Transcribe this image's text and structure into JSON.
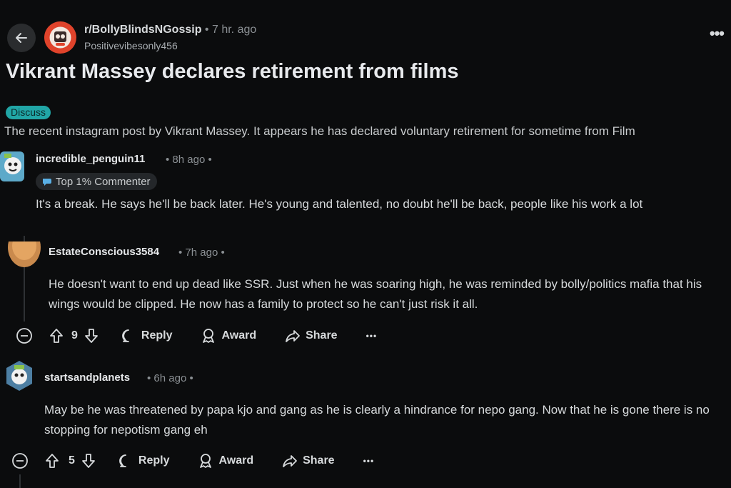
{
  "header": {
    "subreddit": "r/BollyBlindsNGossip",
    "separator": "•",
    "time": "7 hr. ago",
    "author": "Positivevibesonly456",
    "more": "•••",
    "back_icon": "arrow-left-icon"
  },
  "post": {
    "title": "Vikrant Massey declares retirement from films",
    "flair": "Discuss",
    "body": "The recent instagram post by Vikrant Massey. It appears he has declared voluntary retirement for sometime from Film"
  },
  "comments": [
    {
      "username": "incredible_penguin11",
      "meta": "• 8h ago •",
      "badge": "Top 1% Commenter",
      "text": "It's a break. He says he'll be back later. He's young and talented, no doubt he'll be back, people like his work a lot"
    },
    {
      "username": "EstateConscious3584",
      "meta": "• 7h ago •",
      "text": "He doesn't want to end up dead like SSR. Just when he was soaring high, he was reminded by bolly/politics mafia that his wings would be clipped. He now has a family to protect so he can't just risk it all.",
      "votes": "9",
      "reply": "Reply",
      "award": "Award",
      "share": "Share",
      "more": "•••"
    },
    {
      "username": "startsandplanets",
      "meta": "• 6h ago •",
      "text": "May be he was threatened by papa kjo and gang as he is clearly a hindrance for nepo gang. Now that he is gone there is no stopping for nepotism gang eh",
      "votes": "5",
      "reply": "Reply",
      "award": "Award",
      "share": "Share",
      "more": "•••"
    }
  ],
  "colors": {
    "background": "#0b0c0d",
    "flair": "#21a6a6",
    "subreddit_avatar": "#e0432b"
  }
}
